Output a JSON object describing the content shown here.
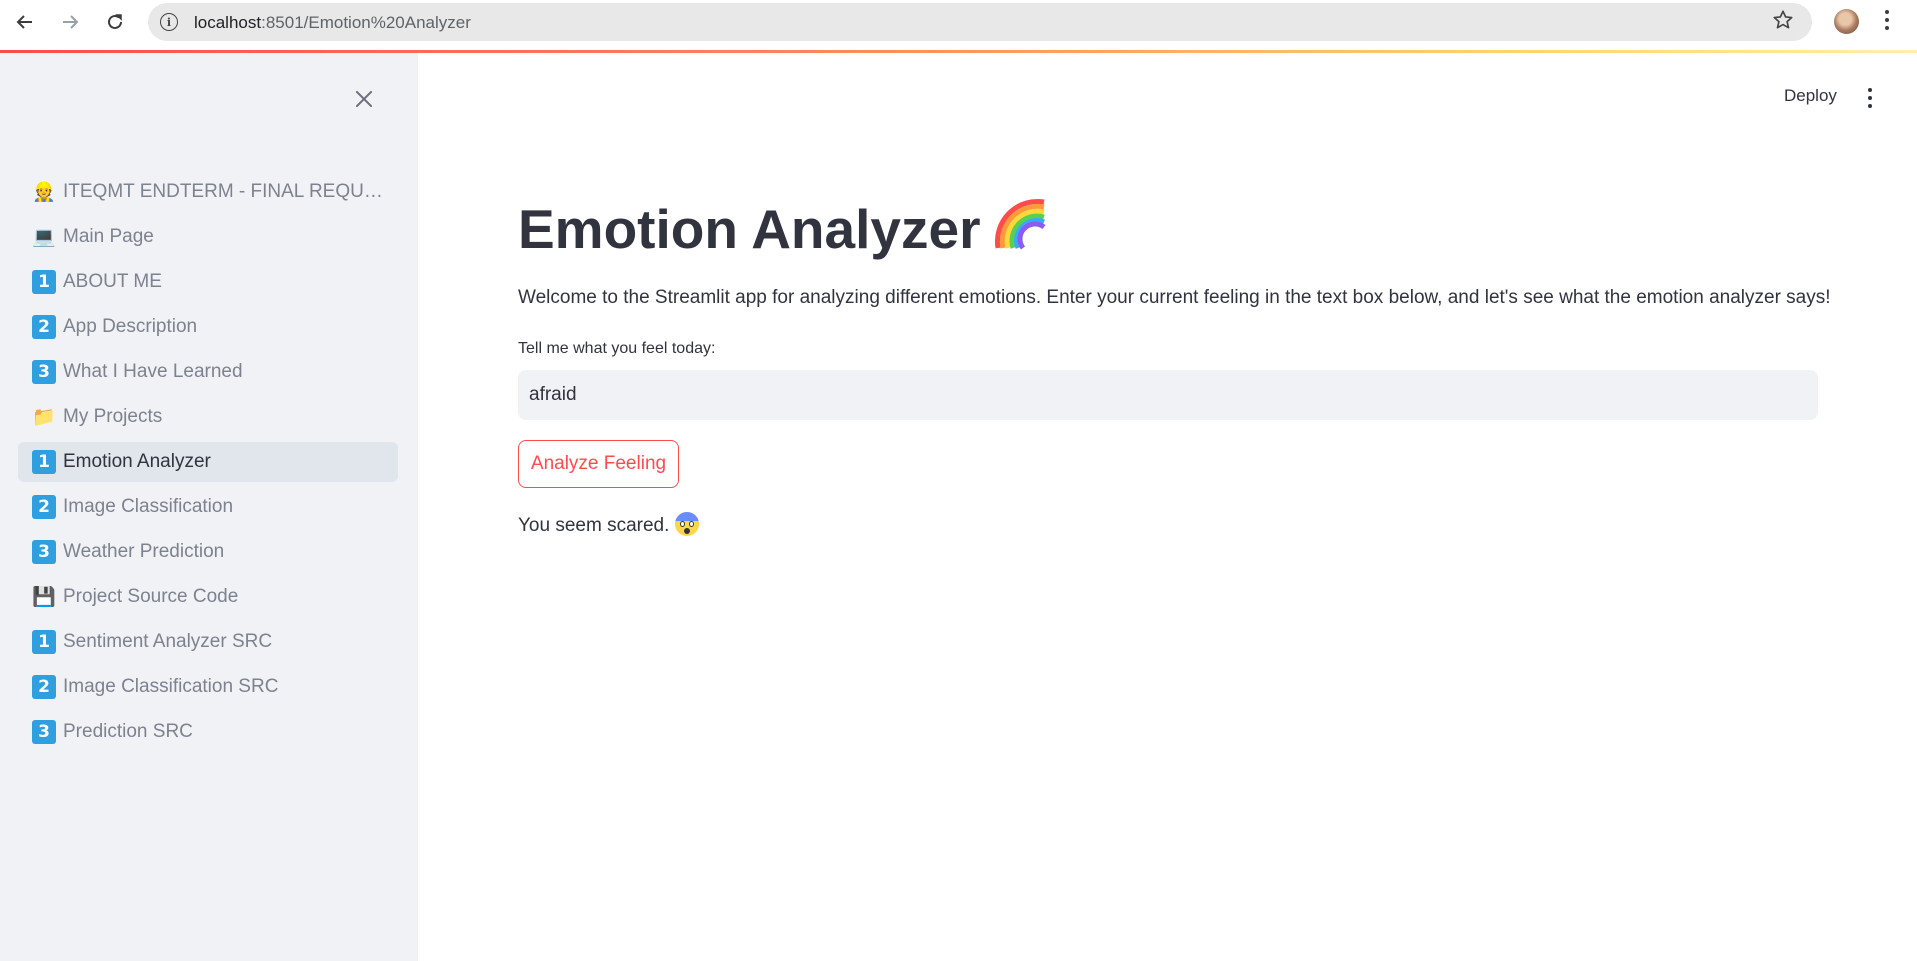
{
  "browser": {
    "url_host": "localhost",
    "url_path": ":8501/Emotion%20Analyzer",
    "info_icon": "info-icon",
    "star_icon": "star-icon"
  },
  "header": {
    "deploy_label": "Deploy"
  },
  "sidebar": {
    "items": [
      {
        "icon": "👷",
        "label": "ITEQMT ENDTERM - FINAL REQUIREMENT",
        "active": false
      },
      {
        "icon": "💻",
        "label": "Main Page",
        "active": false
      },
      {
        "badge": "1",
        "label": "ABOUT ME",
        "active": false
      },
      {
        "badge": "2",
        "label": "App Description",
        "active": false
      },
      {
        "badge": "3",
        "label": "What I Have Learned",
        "active": false
      },
      {
        "icon": "📁",
        "label": "My Projects",
        "active": false
      },
      {
        "badge": "1",
        "label": "Emotion Analyzer",
        "active": true
      },
      {
        "badge": "2",
        "label": "Image Classification",
        "active": false
      },
      {
        "badge": "3",
        "label": "Weather Prediction",
        "active": false
      },
      {
        "icon": "💾",
        "label": "Project Source Code",
        "active": false
      },
      {
        "badge": "1",
        "label": "Sentiment Analyzer SRC",
        "active": false
      },
      {
        "badge": "2",
        "label": "Image Classification SRC",
        "active": false
      },
      {
        "badge": "3",
        "label": "Prediction SRC",
        "active": false
      }
    ]
  },
  "main": {
    "title": "Emotion Analyzer",
    "intro": "Welcome to the Streamlit app for analyzing different emotions. Enter your current feeling in the text box below, and let's see what the emotion analyzer says!",
    "input_label": "Tell me what you feel today:",
    "input_value": "afraid",
    "button_label": "Analyze Feeling",
    "result": "You seem scared."
  },
  "colors": {
    "accent": "#ff4b4b",
    "sidebar_bg": "#f0f2f6",
    "badge": "#2f9fdf",
    "text": "#31333f"
  }
}
